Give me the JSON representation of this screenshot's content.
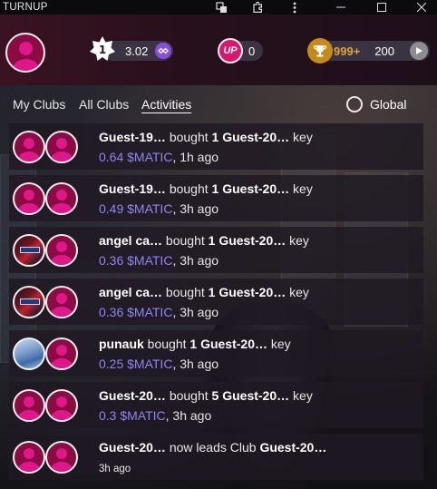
{
  "window": {
    "title": "TURNUP"
  },
  "header": {
    "keys_value": "3.02",
    "up_label": "UP",
    "up_value": "0",
    "trophy_value": "999+",
    "points_value": "200"
  },
  "tabs": {
    "my_clubs": "My Clubs",
    "all_clubs": "All Clubs",
    "activities": "Activities",
    "global": "Global"
  },
  "activities": [
    {
      "user": "Guest-19…",
      "verb": "bought",
      "qty": "1",
      "subject": "Guest-20…",
      "tail": "key",
      "amount": "0.64 $MATIC",
      "time": ", 1h ago",
      "avatar1": "default",
      "avatar2": "default"
    },
    {
      "user": "Guest-19…",
      "verb": "bought",
      "qty": "1",
      "subject": "Guest-20…",
      "tail": "key",
      "amount": "0.49 $MATIC",
      "time": ", 3h ago",
      "avatar1": "default",
      "avatar2": "default"
    },
    {
      "user": "angel ca…",
      "verb": "bought",
      "qty": "1",
      "subject": "Guest-20…",
      "tail": "key",
      "amount": "0.36 $MATIC",
      "time": ", 3h ago",
      "avatar1": "photo",
      "avatar2": "default"
    },
    {
      "user": "angel ca…",
      "verb": "bought",
      "qty": "1",
      "subject": "Guest-20…",
      "tail": "key",
      "amount": "0.36 $MATIC",
      "time": ", 3h ago",
      "avatar1": "photo",
      "avatar2": "default"
    },
    {
      "user": "punauk",
      "verb": "bought",
      "qty": "1",
      "subject": "Guest-20…",
      "tail": "key",
      "amount": "0.25 $MATIC",
      "time": ", 3h ago",
      "avatar1": "photo",
      "avatar2": "default"
    },
    {
      "user": "Guest-20…",
      "verb": "bought",
      "qty": "5",
      "subject": "Guest-20…",
      "tail": "key",
      "amount": "0.3 $MATIC",
      "time": ", 3h ago",
      "avatar1": "default",
      "avatar2": "default"
    },
    {
      "user": "Guest-20…",
      "verb": "now leads Club",
      "subject": "Guest-20…",
      "time": "3h ago",
      "avatar1": "default",
      "avatar2": "default"
    }
  ],
  "colors": {
    "accent": "#8f86f2",
    "header_bg": "#3a1322",
    "avatar": "#e0168b"
  }
}
